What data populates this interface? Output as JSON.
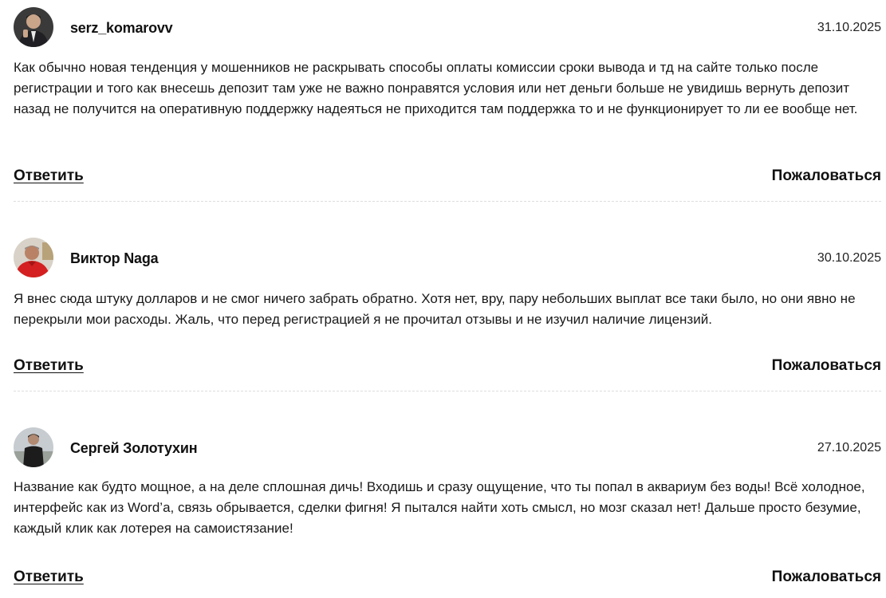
{
  "actions": {
    "reply_label": "Ответить",
    "report_label": "Пожаловаться"
  },
  "comments": [
    {
      "author": "serz_komarovv",
      "date": "31.10.2025",
      "text": "Как обычно новая тенденция у мошенников не раскрывать способы оплаты комиссии сроки вывода и тд на сайте только после регистрации и того как внесешь депозит там уже не важно понравятся условия или нет деньги больше не увидишь вернуть депозит назад не получится на оперативную поддержку надеяться не приходится там поддержка то и не функционирует то ли ее вообще нет."
    },
    {
      "author": "Виктор Naga",
      "date": "30.10.2025",
      "text": "Я внес сюда штуку долларов и не смог ничего забрать обратно. Хотя нет, вру, пару небольших выплат все таки было, но они явно не перекрыли мои расходы. Жаль, что перед регистрацией я не прочитал отзывы и не изучил наличие лицензий."
    },
    {
      "author": "Сергей Золотухин",
      "date": "27.10.2025",
      "text": "Название как будто мощное, а на деле сплошная дичь! Входишь и сразу ощущение, что ты попал в аквариум без воды! Всё холодное, интерфейс как из Word’a, связь обрывается, сделки фигня! Я пытался найти хоть смысл, но мозг сказал нет! Дальше просто безумие, каждый клик как лотерея на самоистязание!"
    }
  ]
}
